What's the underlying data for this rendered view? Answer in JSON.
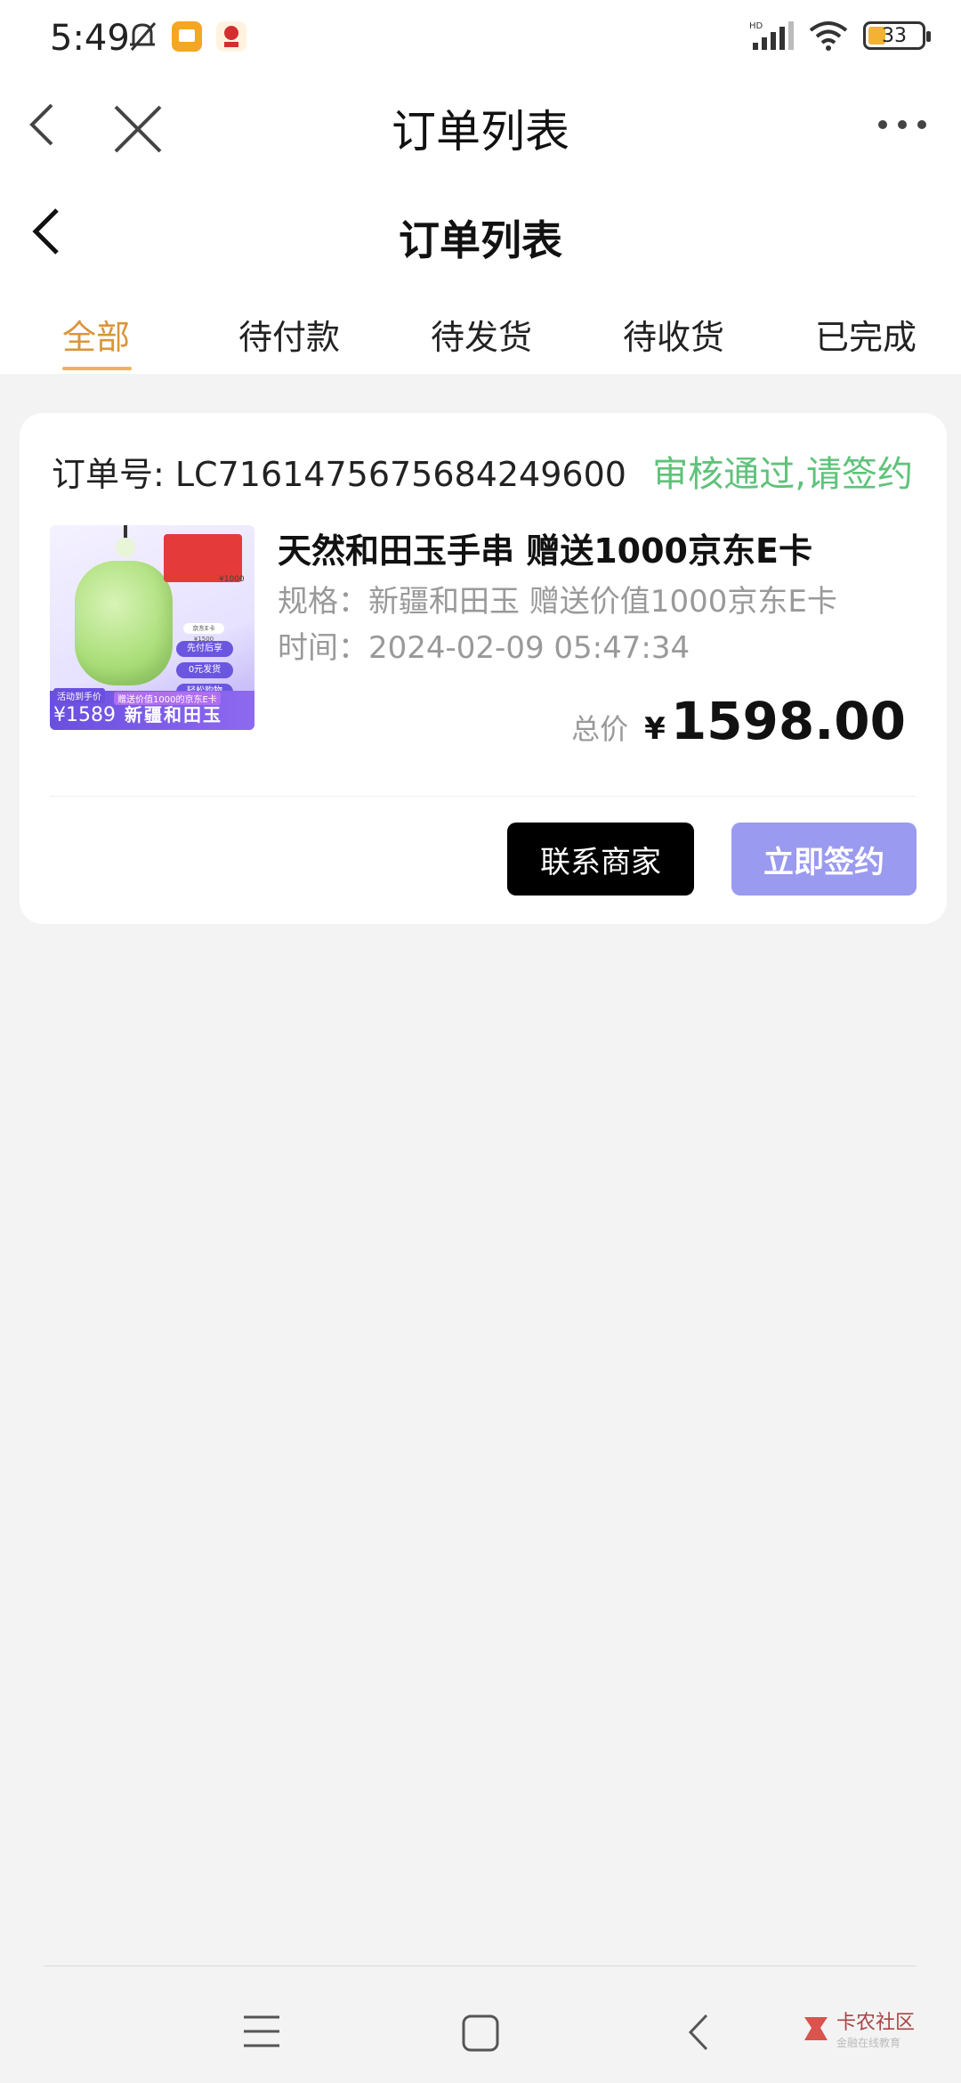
{
  "status_bar": {
    "time": "5:49",
    "network": "HD",
    "battery": "33"
  },
  "browser": {
    "title": "订单列表"
  },
  "page": {
    "title": "订单列表"
  },
  "tabs": [
    {
      "label": "全部",
      "active": true
    },
    {
      "label": "待付款",
      "active": false
    },
    {
      "label": "待发货",
      "active": false
    },
    {
      "label": "待收货",
      "active": false
    },
    {
      "label": "已完成",
      "active": false
    }
  ],
  "order": {
    "number_label": "订单号: LC7161475675684249600",
    "status": "审核通过,请签约",
    "product": {
      "name": "天然和田玉手串 赠送1000京东E卡",
      "spec": "规格：新疆和田玉 赠送价值1000京东E卡",
      "time": "时间：2024-02-09 05:47:34",
      "thumbnail": {
        "price_label": "活动到手价",
        "price": "¥1589",
        "gift_tag": "赠送价值1000的京东E卡",
        "brand": "新疆和田玉",
        "pills": [
          "先付后享",
          "0元发货",
          "轻松购物"
        ],
        "card_price": "¥1000",
        "small_label": "京东E卡 ¥1500"
      }
    },
    "total_label": "总价",
    "currency": "¥",
    "total": "1598.00",
    "buttons": {
      "contact": "联系商家",
      "sign": "立即签约"
    }
  },
  "watermark": {
    "title": "卡农社区",
    "subtitle": "金融在线教育"
  },
  "colors": {
    "accent_tab": "#d9963a",
    "status_green": "#5fc27a",
    "sign_button": "#9a9af0",
    "contact_button": "#000000"
  }
}
